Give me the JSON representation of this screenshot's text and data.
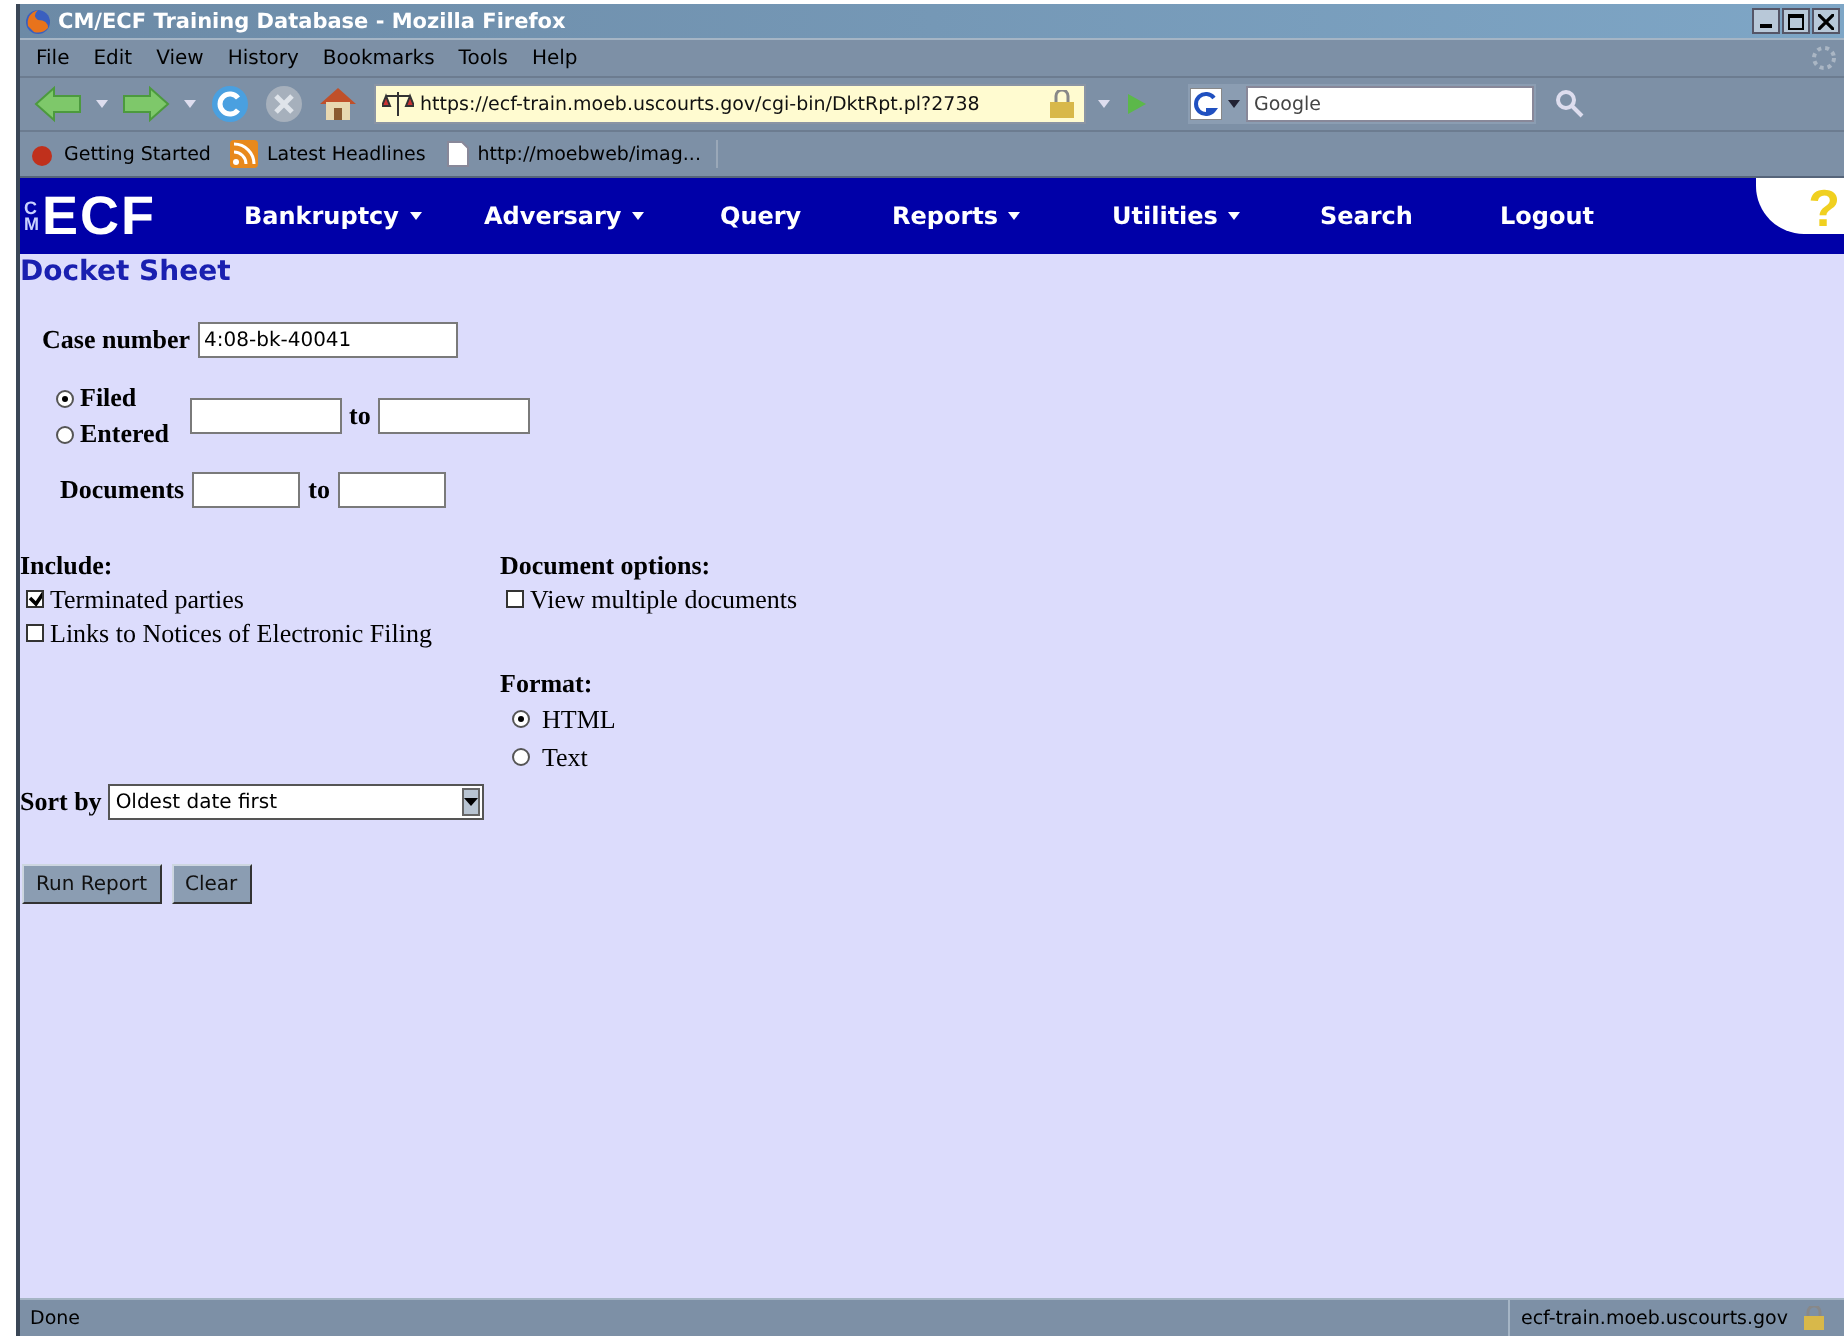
{
  "window": {
    "title": "CM/ECF Training Database - Mozilla Firefox"
  },
  "menu_bar": [
    "File",
    "Edit",
    "View",
    "History",
    "Bookmarks",
    "Tools",
    "Help"
  ],
  "address_bar": {
    "value": "https://ecf-train.moeb.uscourts.gov/cgi-bin/DktRpt.pl?2738"
  },
  "search_bar": {
    "placeholder": "Google"
  },
  "bookmarks": [
    {
      "label": "Getting Started",
      "kind": "start"
    },
    {
      "label": "Latest Headlines",
      "kind": "feed"
    },
    {
      "label": "http://moebweb/imag...",
      "kind": "page"
    }
  ],
  "nav": {
    "logo": "ECF",
    "logo_side": "CM",
    "items": [
      {
        "label": "Bankruptcy",
        "dropdown": true
      },
      {
        "label": "Adversary",
        "dropdown": true
      },
      {
        "label": "Query",
        "dropdown": false
      },
      {
        "label": "Reports",
        "dropdown": true
      },
      {
        "label": "Utilities",
        "dropdown": true
      },
      {
        "label": "Search",
        "dropdown": false
      },
      {
        "label": "Logout",
        "dropdown": false
      }
    ],
    "help": "?"
  },
  "page": {
    "title": "Docket Sheet",
    "case_number": {
      "label": "Case number",
      "value": "4:08-bk-40041"
    },
    "date_type": [
      {
        "label": "Filed",
        "selected": true
      },
      {
        "label": "Entered",
        "selected": false
      }
    ],
    "date_to": "to",
    "documents": {
      "label": "Documents",
      "to": "to"
    },
    "include": {
      "label": "Include:",
      "options": [
        {
          "label": "Terminated parties",
          "checked": true
        },
        {
          "label": "Links to Notices of Electronic Filing",
          "checked": false
        }
      ]
    },
    "document_options": {
      "label": "Document options:",
      "options": [
        {
          "label": "View multiple documents",
          "checked": false
        }
      ]
    },
    "format": {
      "label": "Format:",
      "options": [
        {
          "label": "HTML",
          "selected": true
        },
        {
          "label": "Text",
          "selected": false
        }
      ]
    },
    "sort_by": {
      "label": "Sort by",
      "value": "Oldest date first"
    },
    "buttons": [
      "Run Report",
      "Clear"
    ]
  },
  "status_bar": {
    "text": "Done",
    "host": "ecf-train.moeb.uscourts.gov"
  }
}
